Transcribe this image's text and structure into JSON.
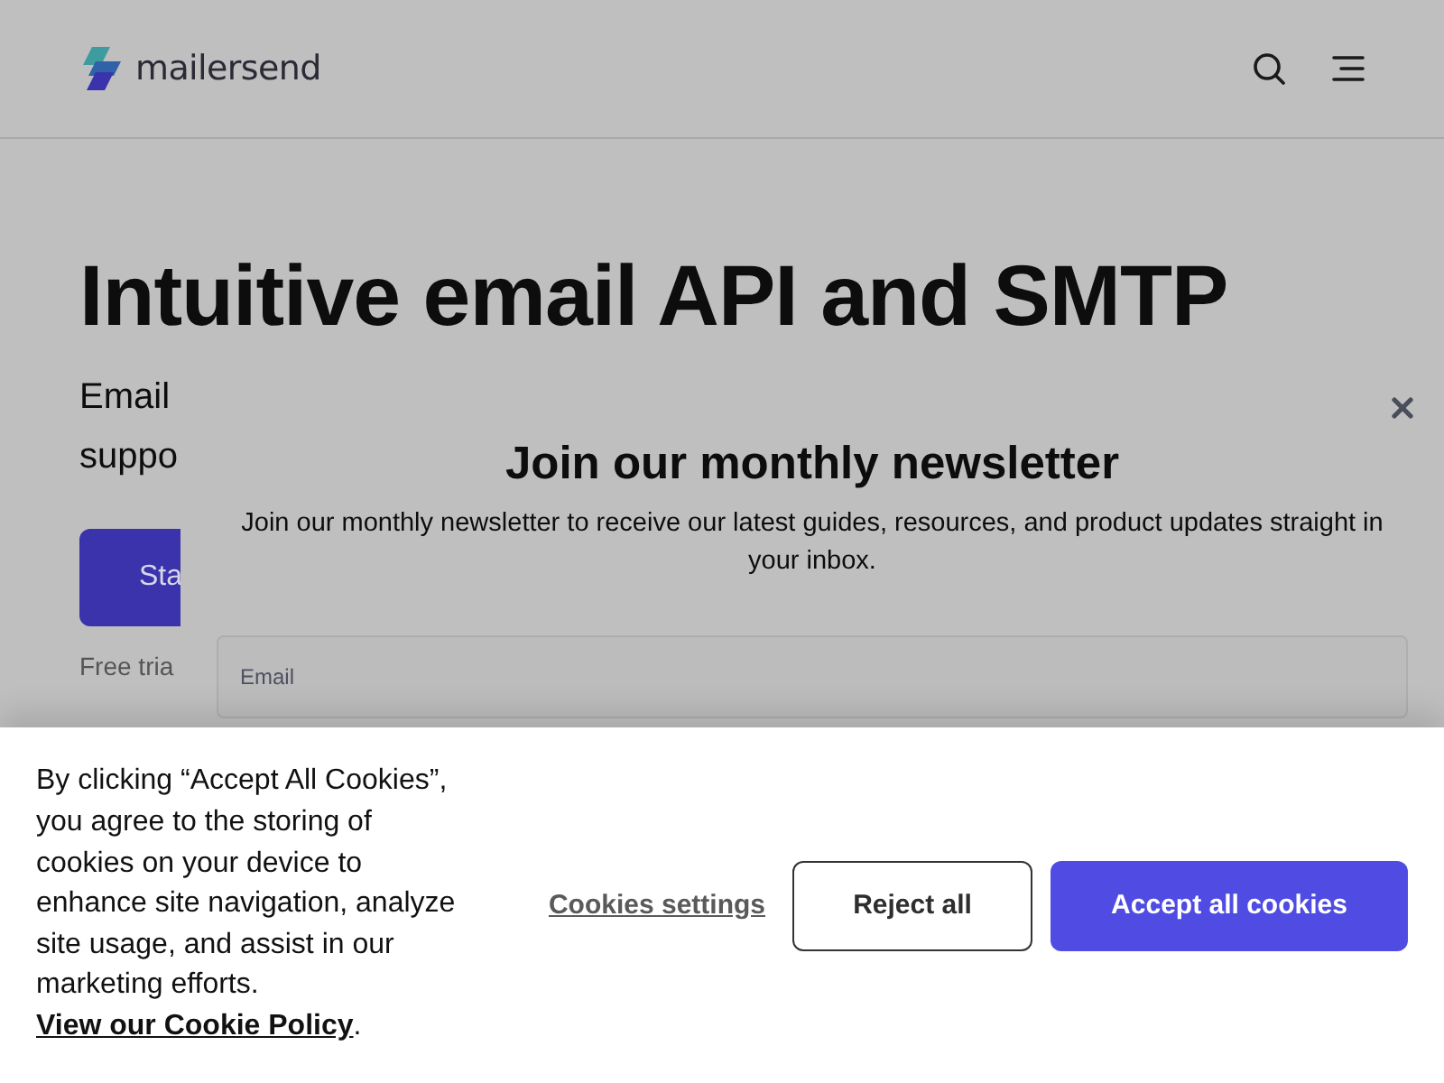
{
  "header": {
    "logo_text": "mailersend"
  },
  "hero": {
    "title": "Intuitive email API and SMTP",
    "subtitle_lines": [
      "Email",
      "suppo"
    ],
    "cta_button": "Sta",
    "note": "Free tria"
  },
  "newsletter_modal": {
    "title": "Join our monthly newsletter",
    "description": "Join our monthly newsletter to receive our latest guides, resources, and product updates straight in your inbox.",
    "email_field": {
      "placeholder": "Email"
    }
  },
  "cookie_banner": {
    "text": "By clicking “Accept All Cookies”, you agree to the storing of cookies on your device to enhance site navigation, analyze site usage, and assist in our marketing efforts.",
    "policy_link": "View our Cookie Policy",
    "text_end": ".",
    "buttons": [
      {
        "kind": "link",
        "label": "Cookies settings"
      },
      {
        "kind": "outline",
        "label": "Reject all"
      },
      {
        "kind": "primary",
        "label": "Accept all cookies"
      }
    ]
  }
}
